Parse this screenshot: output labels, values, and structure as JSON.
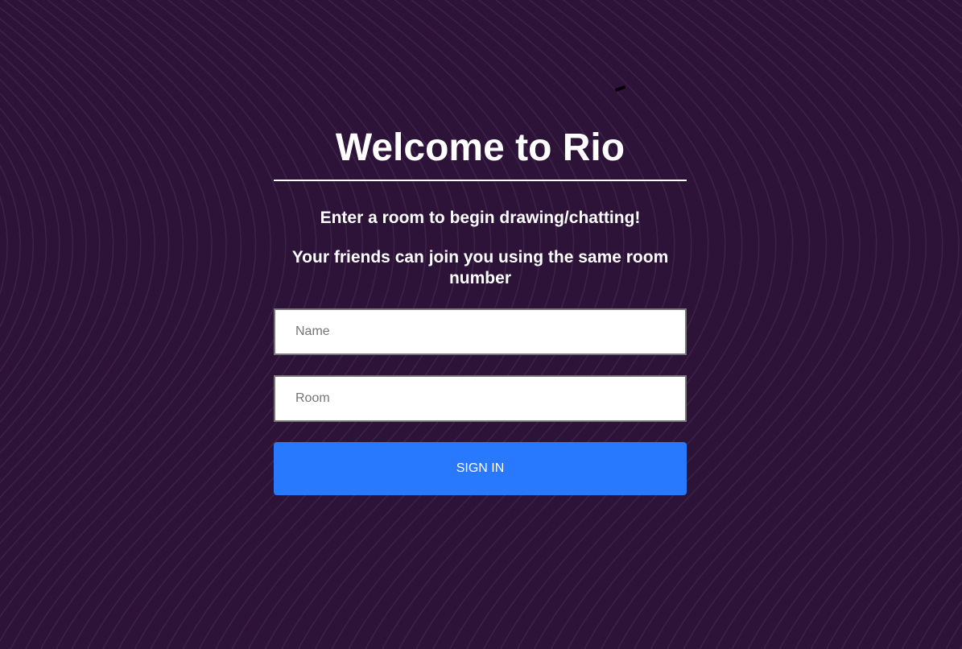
{
  "page": {
    "title": "Welcome to Rio",
    "subtitle_1": "Enter a room to begin drawing/chatting!",
    "subtitle_2": "Your friends can join you using the same room number"
  },
  "form": {
    "name_placeholder": "Name",
    "name_value": "",
    "room_placeholder": "Room",
    "room_value": "",
    "submit_label": "SIGN IN"
  },
  "colors": {
    "background": "#2c1337",
    "background_lines": "#4a2d58",
    "accent_button": "#2979ff",
    "text": "#ffffff"
  }
}
